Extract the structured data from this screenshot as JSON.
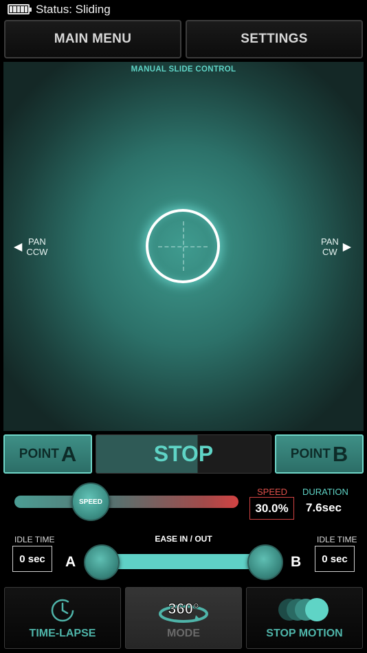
{
  "status": {
    "text": "Status: Sliding",
    "icon": "battery-icon"
  },
  "nav": {
    "main_menu": "MAIN MENU",
    "settings": "SETTINGS"
  },
  "control_pad": {
    "title": "MANUAL SLIDE CONTROL",
    "pan_left_line1": "PAN",
    "pan_left_line2": "CCW",
    "pan_right_line1": "PAN",
    "pan_right_line2": "CW",
    "accent_color": "#5fd4c6"
  },
  "points": {
    "a_word": "POINT",
    "a_letter": "A",
    "b_word": "POINT",
    "b_letter": "B",
    "stop": "STOP"
  },
  "speed": {
    "knob_label": "SPEED",
    "label": "SPEED",
    "value": "30.0%",
    "fraction": 0.3,
    "label_color": "#e0504a"
  },
  "duration": {
    "label": "DURATION",
    "value": "7.6sec"
  },
  "idle": {
    "left_label": "IDLE TIME",
    "left_value": "0 sec",
    "right_label": "IDLE TIME",
    "right_value": "0 sec"
  },
  "ease": {
    "label": "EASE IN / OUT",
    "a": "A",
    "b": "B"
  },
  "modes": [
    {
      "label": "TIME-LAPSE",
      "icon": "clock-icon"
    },
    {
      "label": "MODE",
      "icon": "360-rotate-icon",
      "icon_text": "360°"
    },
    {
      "label": "STOP MOTION",
      "icon": "stop-motion-circles-icon"
    }
  ]
}
